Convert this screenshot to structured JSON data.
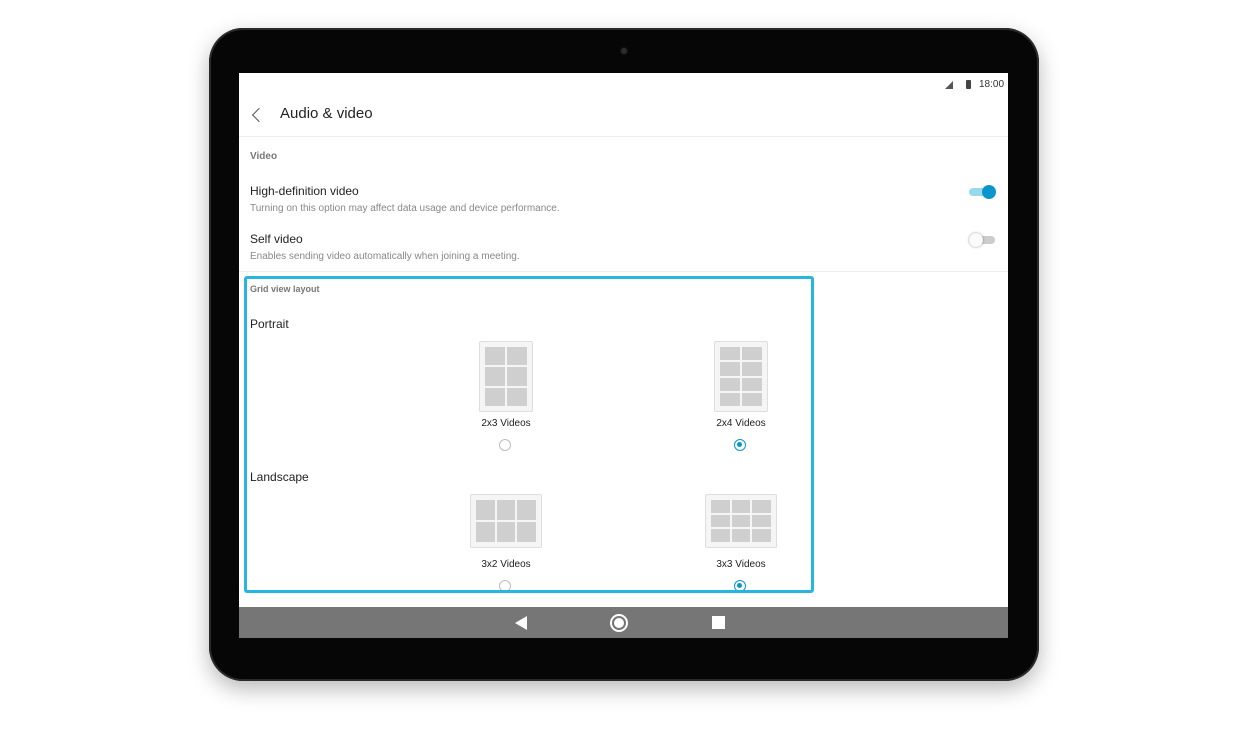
{
  "status_bar": {
    "time": "18:00",
    "icons": [
      "signal-icon",
      "battery-icon"
    ]
  },
  "app_bar": {
    "back_icon": "chevron-left-icon",
    "title": "Audio & video"
  },
  "video_section": {
    "header": "Video",
    "settings": [
      {
        "title": "High-definition video",
        "description": "Turning on this option may affect data usage and device performance.",
        "enabled": true
      },
      {
        "title": "Self video",
        "description": "Enables sending video automatically when joining a meeting.",
        "enabled": false
      }
    ]
  },
  "grid_section": {
    "header": "Grid view layout",
    "highlight_color": "#27b6e0",
    "portrait": {
      "label": "Portrait",
      "options": [
        {
          "label": "2x3 Videos",
          "columns": 2,
          "rows": 3,
          "selected": false
        },
        {
          "label": "2x4 Videos",
          "columns": 2,
          "rows": 4,
          "selected": true
        }
      ]
    },
    "landscape": {
      "label": "Landscape",
      "options": [
        {
          "label": "3x2 Videos",
          "columns": 3,
          "rows": 2,
          "selected": false
        },
        {
          "label": "3x3 Videos",
          "columns": 3,
          "rows": 3,
          "selected": true
        }
      ]
    }
  },
  "nav_bar": {
    "buttons": [
      "back-triangle-icon",
      "home-circle-icon",
      "recents-square-icon"
    ]
  },
  "colors": {
    "accent": "#0a96cc",
    "nav_bar": "#767676",
    "thumbnail_cell": "#cfcfcf"
  }
}
